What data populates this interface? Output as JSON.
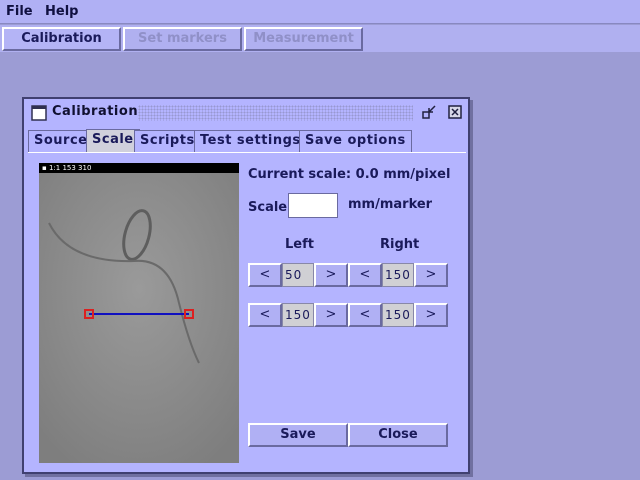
{
  "menu": {
    "file": "File",
    "help": "Help"
  },
  "modes": [
    {
      "label": "Calibration",
      "enabled": true
    },
    {
      "label": "Set markers",
      "enabled": false
    },
    {
      "label": "Measurement",
      "enabled": false
    }
  ],
  "dialog": {
    "title": "Calibration",
    "tabs": [
      "Source",
      "Scale",
      "Scripts",
      "Test settings",
      "Save options"
    ],
    "selected_tab": "Scale",
    "current_scale": "Current scale: 0.0 mm/pixel",
    "scale_label": "Scale",
    "scale_value": "",
    "scale_unit": "mm/marker",
    "left_label": "Left",
    "right_label": "Right",
    "prev": "<",
    "next": ">",
    "rows": [
      {
        "left": "50",
        "right": "150"
      },
      {
        "left": "150",
        "right": "150"
      }
    ],
    "save": "Save",
    "close": "Close",
    "image_overlay_text": "▪ 1:1 153 310"
  },
  "colors": {
    "marker": "#dd2020",
    "line": "#1010c0"
  }
}
